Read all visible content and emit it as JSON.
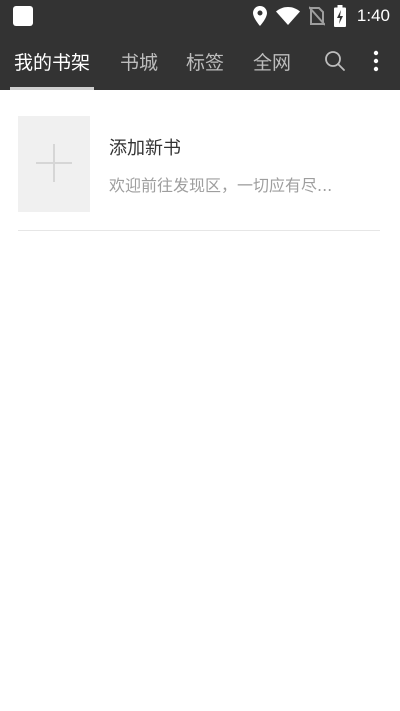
{
  "status_bar": {
    "time": "1:40",
    "icons": [
      "app-notification-icon",
      "location-icon",
      "wifi-icon",
      "no-sim-icon",
      "battery-charging-icon"
    ]
  },
  "toolbar": {
    "tabs": [
      {
        "label": "我的书架",
        "active": true
      },
      {
        "label": "书城",
        "active": false
      },
      {
        "label": "标签",
        "active": false
      },
      {
        "label": "全网",
        "active": false
      }
    ],
    "actions": [
      "search-icon",
      "more-vert-icon"
    ]
  },
  "bookshelf": {
    "items": [
      {
        "title": "添加新书",
        "description": "欢迎前往发现区，一切应有尽...",
        "cover_icon": "plus-icon"
      }
    ]
  },
  "colors": {
    "bar_background": "#333333",
    "active_tab": "#ffffff",
    "inactive_tab": "#bdbdbd",
    "indicator": "#cfcfcf",
    "cover_background": "#f0f0f0"
  }
}
